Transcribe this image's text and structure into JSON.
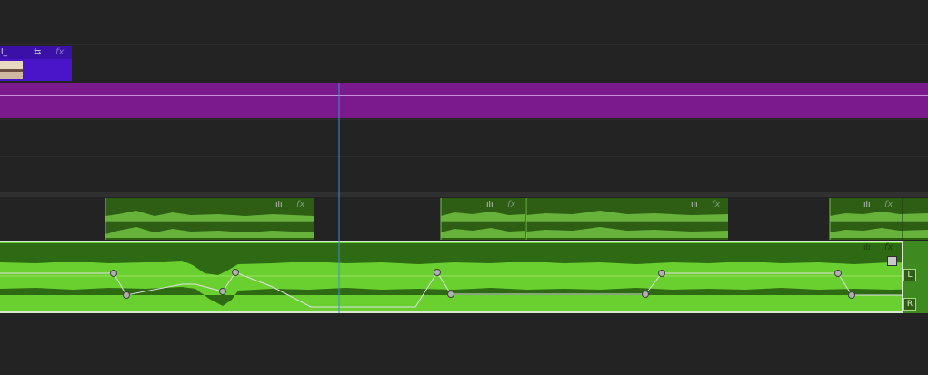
{
  "video_track": {
    "clip_label": "l_",
    "fx_label": "fx",
    "link_icon": "link-icon"
  },
  "audio_clips_upper": [
    {
      "fx_label": "fx",
      "wave_icon": "waveform-icon"
    },
    {
      "fx_label": "fx",
      "wave_icon": "waveform-icon"
    },
    {
      "fx_label": "fx",
      "wave_icon": "waveform-icon"
    },
    {
      "fx_label": "fx",
      "wave_icon": "waveform-icon"
    }
  ],
  "audio_main": {
    "fx_label": "fx",
    "wave_icon": "waveform-icon",
    "left_channel": "L",
    "right_channel": "R"
  },
  "colors": {
    "background": "#232323",
    "video_clip": "#4a14c8",
    "purple_track": "#7a1a8c",
    "audio_clip_dark": "#2e5d14",
    "audio_clip_selected": "#6ad030",
    "playhead": "#3a8fd8"
  }
}
